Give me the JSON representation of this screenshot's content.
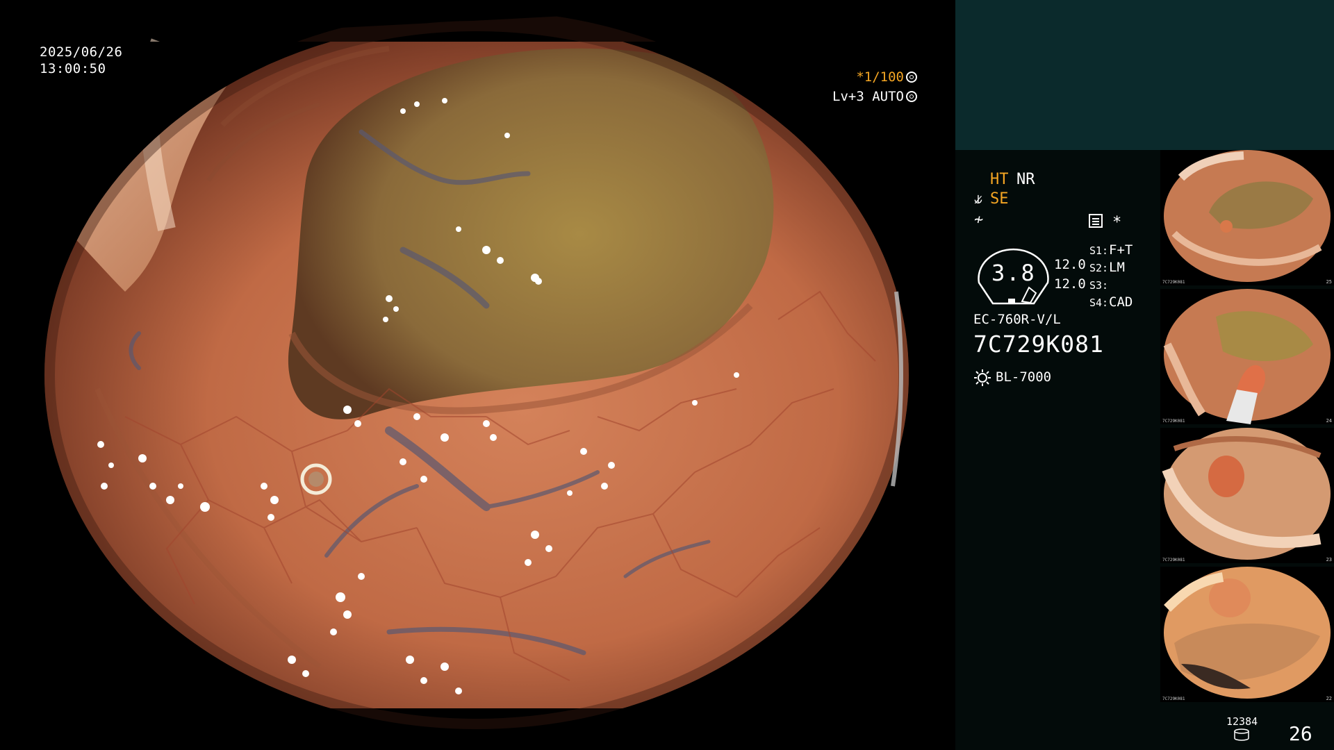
{
  "overlay": {
    "date": "2025/06/26",
    "time": "13:00:50",
    "shutter": "*1/100",
    "level": "Lv+3 AUTO"
  },
  "icons": {
    "shutter": "aperture-icon",
    "level": "auto-iris-icon",
    "se": "scope-arm-icon",
    "sig": "signal-icon",
    "doc": "memo-icon",
    "lamp": "sun-lamp-icon",
    "storage": "database-icon"
  },
  "panel": {
    "ht": "HT",
    "nr": "NR",
    "se": "SE",
    "star": "*",
    "gauge_value": "3.8",
    "val1": "12.0",
    "val2": "12.0",
    "switches": [
      {
        "key": "S1:",
        "value": "F+T"
      },
      {
        "key": "S2:",
        "value": "LM"
      },
      {
        "key": "S3:",
        "value": ""
      },
      {
        "key": "S4:",
        "value": "CAD"
      }
    ],
    "scope_model": "EC-760R-V/L",
    "serial": "7C729K081",
    "light_source": "BL-7000"
  },
  "thumbnails": [
    {
      "number": "25",
      "label": "7C729K081"
    },
    {
      "number": "24",
      "label": "7C729K081"
    },
    {
      "number": "23",
      "label": "7C729K081"
    },
    {
      "number": "22",
      "label": "7C729K081"
    }
  ],
  "footer": {
    "storage_count": "12384",
    "image_count": "26"
  },
  "colors": {
    "accent": "#f5a623",
    "panel_top": "#0b2a2c",
    "panel_bg": "#030b0a",
    "mucosa": "#c8734e"
  }
}
